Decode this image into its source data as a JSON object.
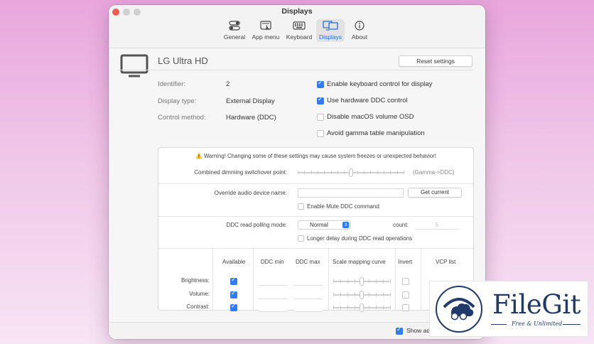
{
  "window": {
    "title": "Displays"
  },
  "tabs": [
    {
      "label": "General",
      "icon": "toggles-icon"
    },
    {
      "label": "App menu",
      "icon": "menu-cursor-icon"
    },
    {
      "label": "Keyboard",
      "icon": "keyboard-icon"
    },
    {
      "label": "Displays",
      "icon": "displays-icon",
      "active": true
    },
    {
      "label": "About",
      "icon": "info-icon"
    }
  ],
  "display": {
    "name": "LG Ultra HD",
    "reset_label": "Reset settings",
    "identifier_label": "Identifier:",
    "identifier_value": "2",
    "type_label": "Display type:",
    "type_value": "External Display",
    "control_label": "Control method:",
    "control_value": "Hardware (DDC)"
  },
  "options": [
    {
      "label": "Enable keyboard control for display",
      "checked": true
    },
    {
      "label": "Use hardware DDC control",
      "checked": true
    },
    {
      "label": "Disable macOS volume OSD",
      "checked": false
    },
    {
      "label": "Avoid gamma table manipulation",
      "checked": false
    }
  ],
  "advanced": {
    "warning": "⚠️ Warning! Changing some of these settings may cause system freezes or unexpected behavior!",
    "dimming_label": "Combined dimming switchover point:",
    "dimming_hint": "(Gamma->DDC)",
    "dimming_value": 0.5,
    "audio_label": "Override audio device name:",
    "audio_value": "",
    "get_current_label": "Get current",
    "mute_ddc_label": "Enable Mute DDC command",
    "mute_ddc_checked": false,
    "polling_label": "DDC read polling mode:",
    "polling_value": "Normal",
    "count_label": "count:",
    "count_placeholder": "5",
    "longer_delay_label": "Longer delay during DDC read operations",
    "longer_delay_checked": false
  },
  "ddc_table": {
    "columns": [
      "Available",
      "DDC min",
      "DDC max",
      "Scale mapping curve",
      "Invert",
      "VCP list"
    ],
    "rows": [
      {
        "label": "Brightness:",
        "available": true,
        "invert": false
      },
      {
        "label": "Volume:",
        "available": true,
        "invert": false
      },
      {
        "label": "Contrast:",
        "available": true,
        "invert": false
      }
    ]
  },
  "footer": {
    "show_label": "Show ad"
  },
  "watermark": {
    "brand": "FileGit",
    "tagline": "Free & Unlimited"
  },
  "colors": {
    "accent": "#2f7cf6",
    "close": "#ee5e56",
    "brand": "#1f3a6b"
  }
}
